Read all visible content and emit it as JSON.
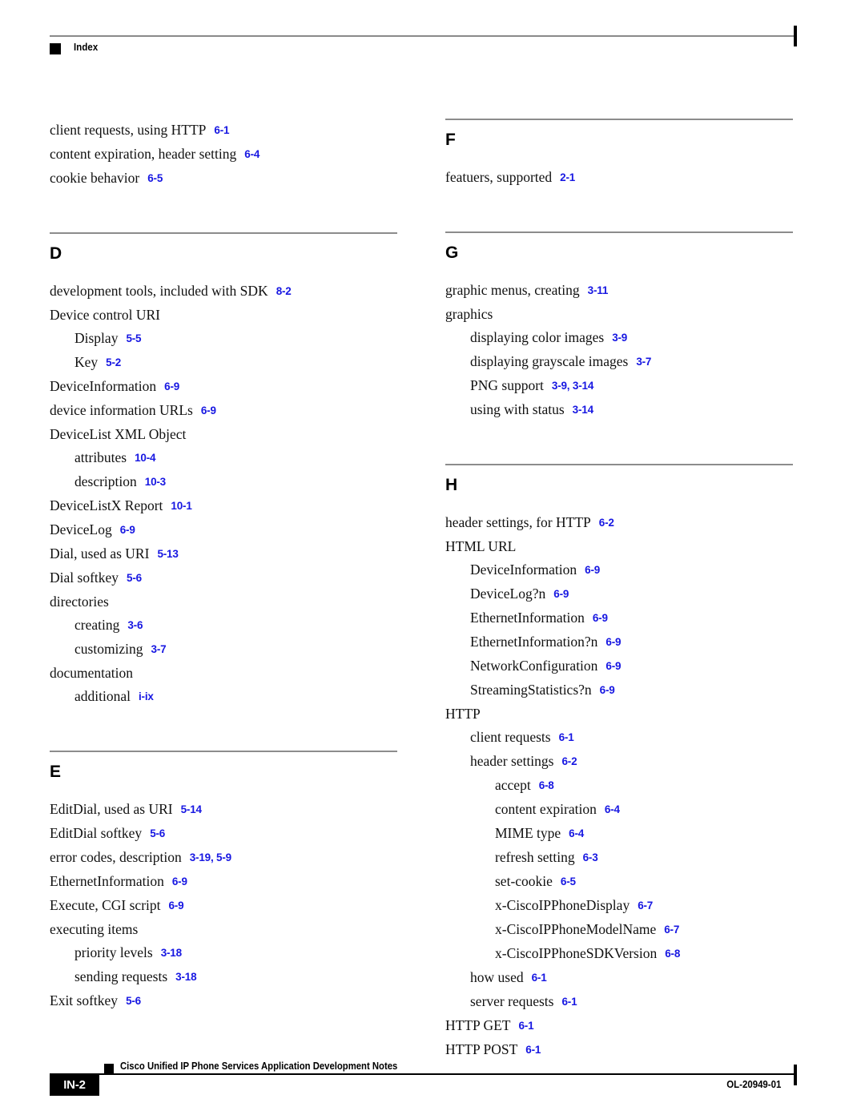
{
  "header": {
    "title": "Index",
    "marker_icon": "black-square-icon"
  },
  "columns": {
    "left": [
      {
        "type": "entries",
        "items": [
          {
            "level": 0,
            "text": "client requests, using HTTP",
            "page": "6-1"
          },
          {
            "level": 0,
            "text": "content expiration, header setting",
            "page": "6-4"
          },
          {
            "level": 0,
            "text": "cookie behavior",
            "page": "6-5"
          }
        ]
      },
      {
        "type": "section",
        "letter": "D",
        "items": [
          {
            "level": 0,
            "text": "development tools, included with SDK",
            "page": "8-2"
          },
          {
            "level": 0,
            "text": "Device control URI",
            "page": ""
          },
          {
            "level": 1,
            "text": "Display",
            "page": "5-5"
          },
          {
            "level": 1,
            "text": "Key",
            "page": "5-2"
          },
          {
            "level": 0,
            "text": "DeviceInformation",
            "page": "6-9"
          },
          {
            "level": 0,
            "text": "device information URLs",
            "page": "6-9"
          },
          {
            "level": 0,
            "text": "DeviceList XML Object",
            "page": ""
          },
          {
            "level": 1,
            "text": "attributes",
            "page": "10-4"
          },
          {
            "level": 1,
            "text": "description",
            "page": "10-3"
          },
          {
            "level": 0,
            "text": "DeviceListX Report",
            "page": "10-1"
          },
          {
            "level": 0,
            "text": "DeviceLog",
            "page": "6-9"
          },
          {
            "level": 0,
            "text": "Dial, used as URI",
            "page": "5-13"
          },
          {
            "level": 0,
            "text": "Dial softkey",
            "page": "5-6"
          },
          {
            "level": 0,
            "text": "directories",
            "page": ""
          },
          {
            "level": 1,
            "text": "creating",
            "page": "3-6"
          },
          {
            "level": 1,
            "text": "customizing",
            "page": "3-7"
          },
          {
            "level": 0,
            "text": "documentation",
            "page": ""
          },
          {
            "level": 1,
            "text": "additional",
            "page": "i-ix"
          }
        ]
      },
      {
        "type": "section",
        "letter": "E",
        "items": [
          {
            "level": 0,
            "text": "EditDial, used as URI",
            "page": "5-14"
          },
          {
            "level": 0,
            "text": "EditDial softkey",
            "page": "5-6"
          },
          {
            "level": 0,
            "text": "error codes, description",
            "page": "3-19, 5-9"
          },
          {
            "level": 0,
            "text": "EthernetInformation",
            "page": "6-9"
          },
          {
            "level": 0,
            "text": "Execute, CGI script",
            "page": "6-9"
          },
          {
            "level": 0,
            "text": "executing items",
            "page": ""
          },
          {
            "level": 1,
            "text": "priority levels",
            "page": "3-18"
          },
          {
            "level": 1,
            "text": "sending requests",
            "page": "3-18"
          },
          {
            "level": 0,
            "text": "Exit softkey",
            "page": "5-6"
          }
        ]
      }
    ],
    "right": [
      {
        "type": "section",
        "letter": "F",
        "first": true,
        "items": [
          {
            "level": 0,
            "text": "featuers, supported",
            "page": "2-1"
          }
        ]
      },
      {
        "type": "section",
        "letter": "G",
        "items": [
          {
            "level": 0,
            "text": "graphic menus, creating",
            "page": "3-11"
          },
          {
            "level": 0,
            "text": "graphics",
            "page": ""
          },
          {
            "level": 1,
            "text": "displaying color images",
            "page": "3-9"
          },
          {
            "level": 1,
            "text": "displaying grayscale images",
            "page": "3-7"
          },
          {
            "level": 1,
            "text": "PNG support",
            "page": "3-9, 3-14"
          },
          {
            "level": 1,
            "text": "using with status",
            "page": "3-14"
          }
        ]
      },
      {
        "type": "section",
        "letter": "H",
        "items": [
          {
            "level": 0,
            "text": "header settings, for HTTP",
            "page": "6-2"
          },
          {
            "level": 0,
            "text": "HTML URL",
            "page": ""
          },
          {
            "level": 1,
            "text": "DeviceInformation",
            "page": "6-9"
          },
          {
            "level": 1,
            "text": "DeviceLog?n",
            "page": "6-9"
          },
          {
            "level": 1,
            "text": "EthernetInformation",
            "page": "6-9"
          },
          {
            "level": 1,
            "text": "EthernetInformation?n",
            "page": "6-9"
          },
          {
            "level": 1,
            "text": "NetworkConfiguration",
            "page": "6-9"
          },
          {
            "level": 1,
            "text": "StreamingStatistics?n",
            "page": "6-9"
          },
          {
            "level": 0,
            "text": "HTTP",
            "page": ""
          },
          {
            "level": 1,
            "text": "client requests",
            "page": "6-1"
          },
          {
            "level": 1,
            "text": "header settings",
            "page": "6-2"
          },
          {
            "level": 2,
            "text": "accept",
            "page": "6-8"
          },
          {
            "level": 2,
            "text": "content expiration",
            "page": "6-4"
          },
          {
            "level": 2,
            "text": "MIME type",
            "page": "6-4"
          },
          {
            "level": 2,
            "text": "refresh setting",
            "page": "6-3"
          },
          {
            "level": 2,
            "text": "set-cookie",
            "page": "6-5"
          },
          {
            "level": 2,
            "text": "x-CiscoIPPhoneDisplay",
            "page": "6-7"
          },
          {
            "level": 2,
            "text": "x-CiscoIPPhoneModelName",
            "page": "6-7"
          },
          {
            "level": 2,
            "text": "x-CiscoIPPhoneSDKVersion",
            "page": "6-8"
          },
          {
            "level": 1,
            "text": "how used",
            "page": "6-1"
          },
          {
            "level": 1,
            "text": "server requests",
            "page": "6-1"
          },
          {
            "level": 0,
            "text": "HTTP GET",
            "page": "6-1"
          },
          {
            "level": 0,
            "text": "HTTP POST",
            "page": "6-1"
          }
        ]
      }
    ]
  },
  "footer": {
    "page_number": "IN-2",
    "document_title": "Cisco Unified IP Phone Services Application Development Notes",
    "document_id": "OL-20949-01",
    "marker_icon": "black-square-icon"
  },
  "colors": {
    "page_reference": "#1717E2",
    "rule_grey": "#8c8c8c",
    "marker_black": "#000000"
  }
}
